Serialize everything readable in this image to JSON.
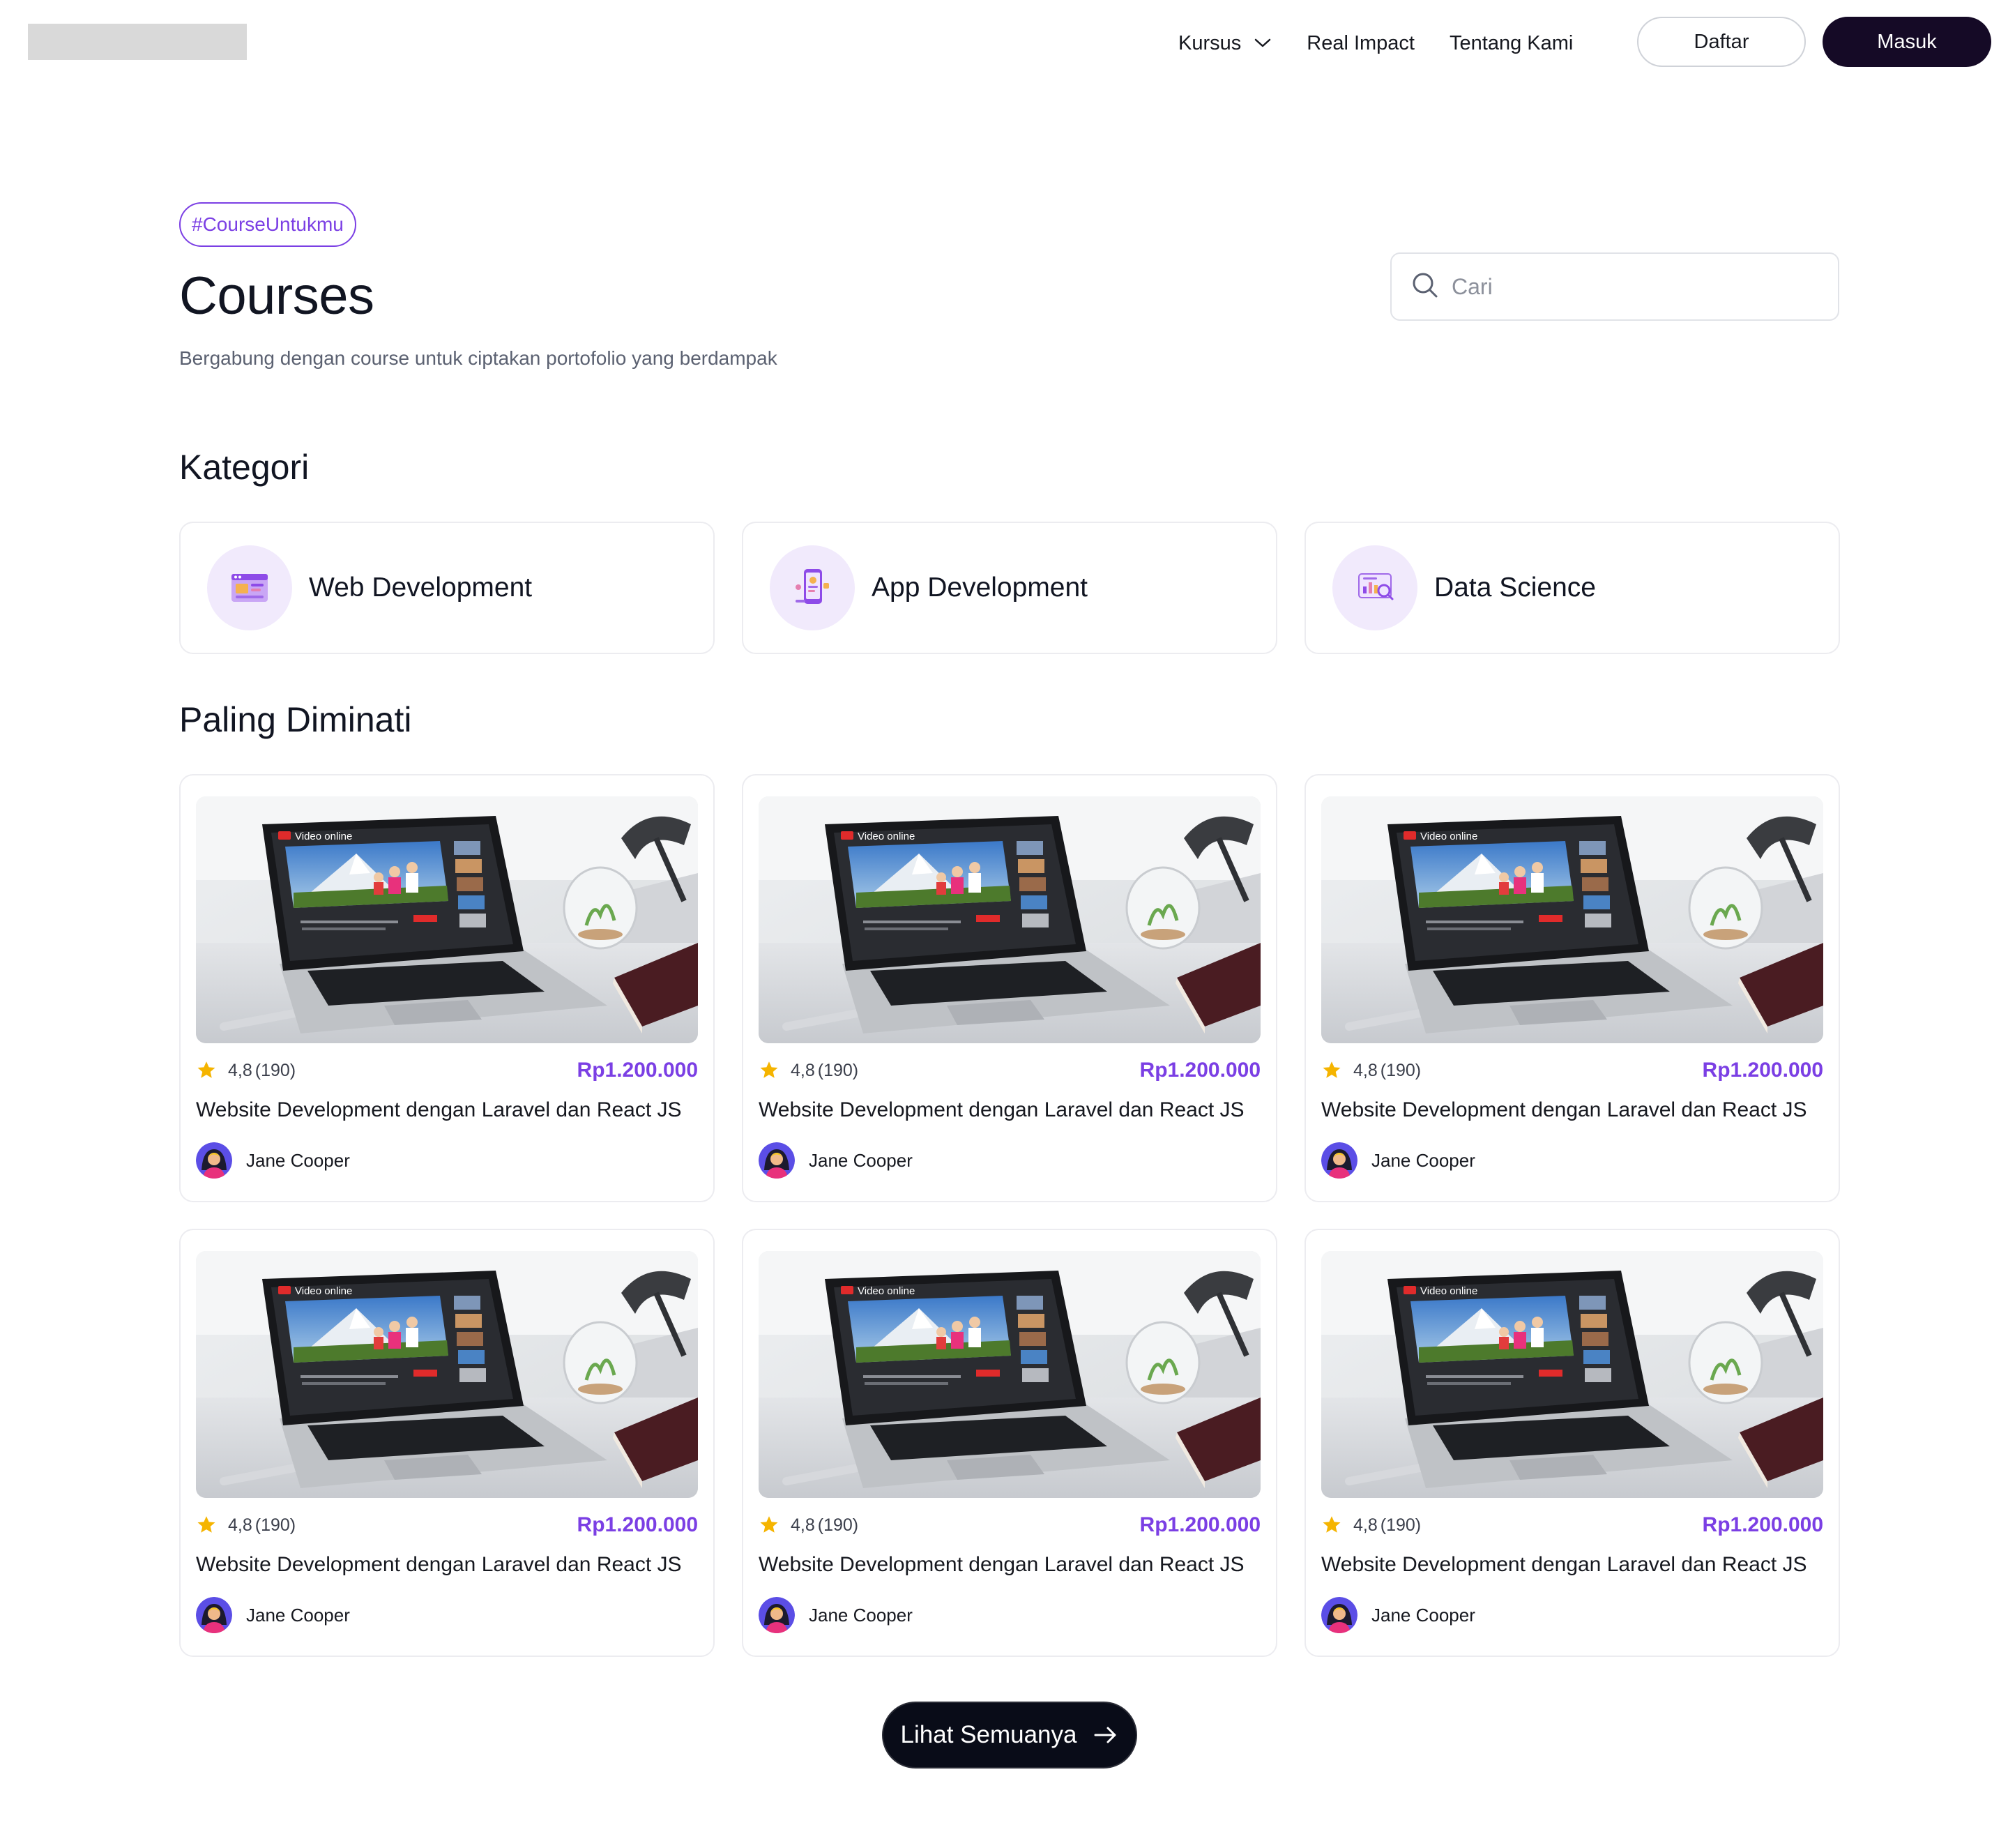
{
  "nav": {
    "items": [
      {
        "label": "Kursus",
        "has_dropdown": true
      },
      {
        "label": "Real Impact"
      },
      {
        "label": "Tentang Kami"
      }
    ],
    "register_label": "Daftar",
    "login_label": "Masuk"
  },
  "hero": {
    "tag": "#CourseUntukmu",
    "title": "Courses",
    "subtitle": "Bergabung dengan course untuk ciptakan portofolio yang berdampak",
    "search_placeholder": "Cari"
  },
  "categories": {
    "title": "Kategori",
    "items": [
      {
        "label": "Web Development",
        "icon": "web-development-icon"
      },
      {
        "label": "App Development",
        "icon": "app-development-icon"
      },
      {
        "label": "Data Science",
        "icon": "data-science-icon"
      }
    ]
  },
  "popular": {
    "title": "Paling Diminati",
    "courses": [
      {
        "rating": "4,8",
        "reviews": "(190)",
        "price": "Rp1.200.000",
        "title": "Website Development dengan Laravel dan React JS",
        "author": "Jane Cooper"
      },
      {
        "rating": "4,8",
        "reviews": "(190)",
        "price": "Rp1.200.000",
        "title": "Website Development dengan Laravel dan React JS",
        "author": "Jane Cooper"
      },
      {
        "rating": "4,8",
        "reviews": "(190)",
        "price": "Rp1.200.000",
        "title": "Website Development dengan Laravel dan React JS",
        "author": "Jane Cooper"
      },
      {
        "rating": "4,8",
        "reviews": "(190)",
        "price": "Rp1.200.000",
        "title": "Website Development dengan Laravel dan React JS",
        "author": "Jane Cooper"
      },
      {
        "rating": "4,8",
        "reviews": "(190)",
        "price": "Rp1.200.000",
        "title": "Website Development dengan Laravel dan React JS",
        "author": "Jane Cooper"
      },
      {
        "rating": "4,8",
        "reviews": "(190)",
        "price": "Rp1.200.000",
        "title": "Website Development dengan Laravel dan React JS",
        "author": "Jane Cooper"
      }
    ],
    "thumbnail_text": "Video online",
    "see_all_label": "Lihat Semuanya"
  },
  "colors": {
    "accent": "#7b3fe4",
    "dark": "#150a26",
    "star": "#f5b400"
  }
}
